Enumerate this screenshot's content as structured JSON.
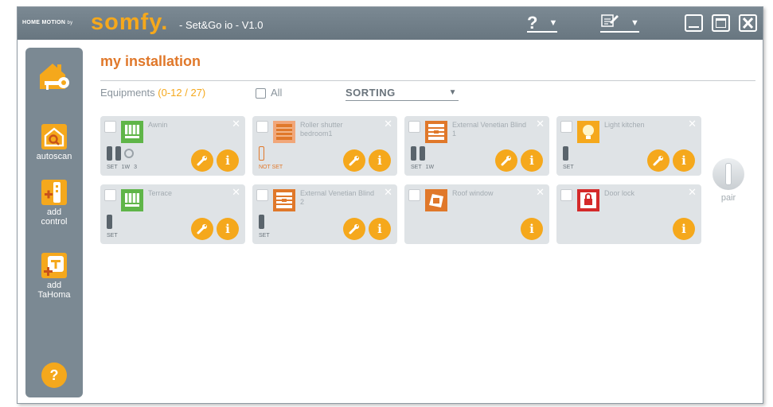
{
  "titlebar": {
    "brand_prefix": "HOME MOTION",
    "brand_by": "by",
    "logo_text": "somfy.",
    "app_title": "- Set&Go io - V1.0",
    "help_menu": "?",
    "settings_menu": "settings-menu-icon"
  },
  "sidebar": {
    "items": [
      {
        "label": "",
        "icon": "home-key-icon"
      },
      {
        "label": "autoscan",
        "icon": "autoscan-icon"
      },
      {
        "label": "add\ncontrol",
        "icon": "add-control-icon"
      },
      {
        "label": "add\nTaHoma",
        "icon": "add-tahoma-icon"
      }
    ],
    "help_label": "?"
  },
  "main": {
    "title": "my installation",
    "equipments_label": "Equipments",
    "equipments_count": "(0-12 / 27)",
    "all_label": "All",
    "sorting_label": "SORTING"
  },
  "cards": [
    {
      "name": "Awnin",
      "icon": "awning-icon",
      "status": [
        "SET",
        "1W",
        "3"
      ],
      "not_set": false,
      "has_wrench": true
    },
    {
      "name": "Roller shutter bedroom1",
      "icon": "roller-shutter-icon",
      "status": [
        "NOT SET"
      ],
      "not_set": true,
      "has_wrench": true
    },
    {
      "name": "External Venetian Blind 1",
      "icon": "venetian-blind-icon",
      "status": [
        "SET",
        "1W"
      ],
      "not_set": false,
      "has_wrench": true
    },
    {
      "name": "Light kitchen",
      "icon": "light-icon",
      "status": [
        "SET"
      ],
      "not_set": false,
      "has_wrench": true
    },
    {
      "name": "Terrace",
      "icon": "awning-icon",
      "status": [
        "SET"
      ],
      "not_set": false,
      "has_wrench": true
    },
    {
      "name": "External Venetian Blind 2",
      "icon": "venetian-blind-icon",
      "status": [
        "SET"
      ],
      "not_set": false,
      "has_wrench": true
    },
    {
      "name": "Roof window",
      "icon": "roof-window-icon",
      "status": [],
      "not_set": false,
      "has_wrench": false
    },
    {
      "name": "Door lock",
      "icon": "door-lock-icon",
      "status": [],
      "not_set": false,
      "has_wrench": false
    }
  ],
  "pair": {
    "label": "pair"
  },
  "colors": {
    "accent": "#f5a81c",
    "title": "#e0782a",
    "titlebar": "#6e7c86",
    "card_bg": "#dfe3e6"
  }
}
